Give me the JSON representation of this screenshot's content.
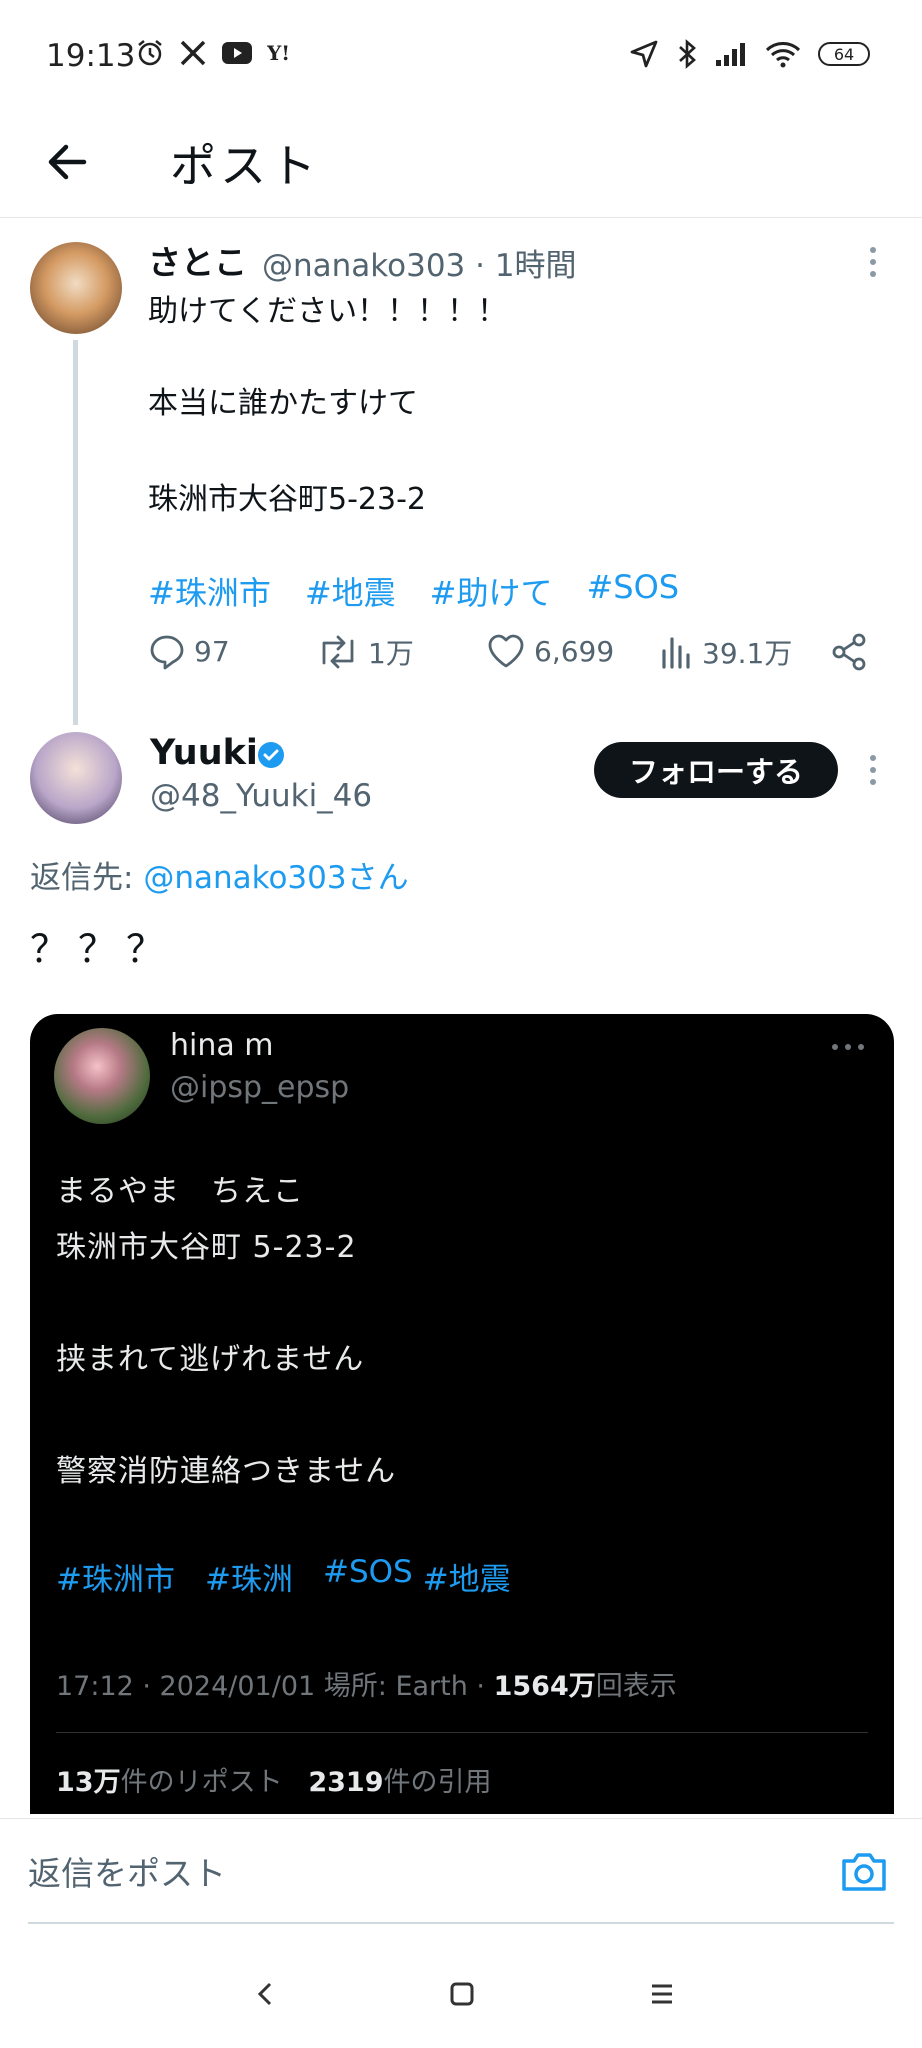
{
  "status_bar": {
    "time": "19:13",
    "battery": "64",
    "left_icons": [
      "alarm-icon",
      "x-logo-icon",
      "youtube-icon",
      "yahoo-icon"
    ],
    "right_icons": [
      "location-icon",
      "bluetooth-icon",
      "signal-icon",
      "wifi-icon",
      "battery-icon"
    ]
  },
  "header": {
    "title": "ポスト"
  },
  "post1": {
    "name": "さとこ",
    "handle": "@nanako303 · 1時間",
    "lines": [
      "助けてください！！！！！",
      "本当に誰かたすけて",
      "珠洲市大谷町5-23-2"
    ],
    "hashtags": [
      "#珠洲市",
      "#地震",
      "#助けて",
      "#SOS"
    ],
    "actions": {
      "replies": "97",
      "reposts": "1万",
      "likes": "6,699",
      "views": "39.1万"
    }
  },
  "post2": {
    "name": "Yuuki",
    "handle": "@48_Yuuki_46",
    "follow_label": "フォローする",
    "reply_prefix": "返信先: ",
    "reply_mention": "@nanako303さん",
    "body": "？？？"
  },
  "embedded": {
    "name": "hina m",
    "handle": "@ipsp_epsp",
    "lines": [
      "まるやま　ちえこ",
      "珠洲市大谷町 5-23-2",
      "挟まれて逃げれません",
      "警察消防連絡つきません"
    ],
    "hashtags": [
      "#珠洲市",
      "#珠洲",
      "#SOS",
      "#地震"
    ],
    "meta_prefix": "17:12 · 2024/01/01 場所: Earth · ",
    "meta_views": "1564万",
    "meta_suffix": "回表示",
    "reposts_count": "13万",
    "reposts_label": "件のリポスト",
    "quotes_count": "2319",
    "quotes_label": "件の引用"
  },
  "reply_bar": {
    "placeholder": "返信をポスト"
  },
  "colors": {
    "link": "#1d9bf0",
    "text": "#0f1419",
    "muted": "#536471"
  }
}
